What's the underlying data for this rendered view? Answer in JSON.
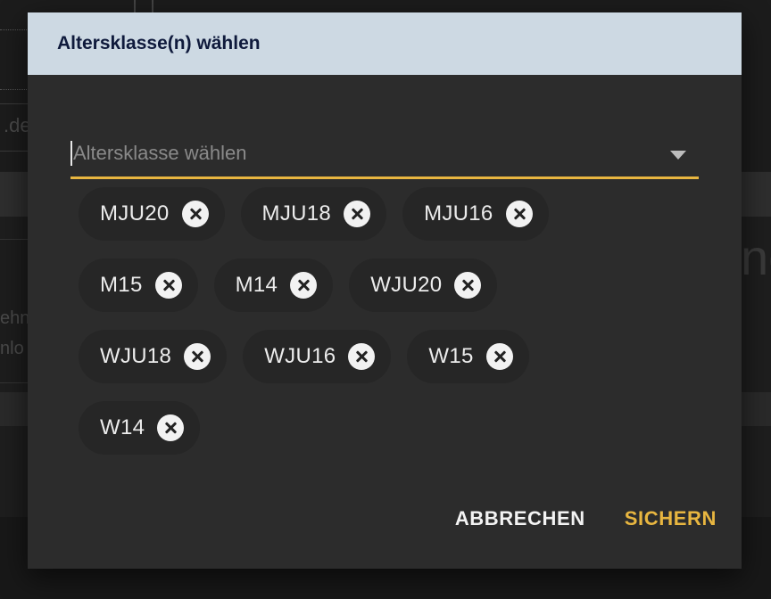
{
  "background": {
    "input_text": ".de",
    "big_text": "ne",
    "card_line_1": "ehn",
    "card_line_2": "nlo"
  },
  "dialog": {
    "title": "Altersklasse(n) wählen",
    "select": {
      "placeholder": "Altersklasse wählen"
    },
    "chip_rows": [
      [
        "MJU20",
        "MJU18",
        "MJU16"
      ],
      [
        "M15",
        "M14",
        "WJU20"
      ],
      [
        "WJU18",
        "WJU16",
        "W15"
      ],
      [
        "W14"
      ]
    ],
    "actions": {
      "cancel": "ABBRECHEN",
      "save": "SICHERN"
    }
  },
  "colors": {
    "header_bg": "#cdd9e3",
    "title_text": "#0f1a3c",
    "accent": "#e8b640",
    "dialog_bg": "#2c2c2c",
    "chip_bg": "#262626"
  }
}
